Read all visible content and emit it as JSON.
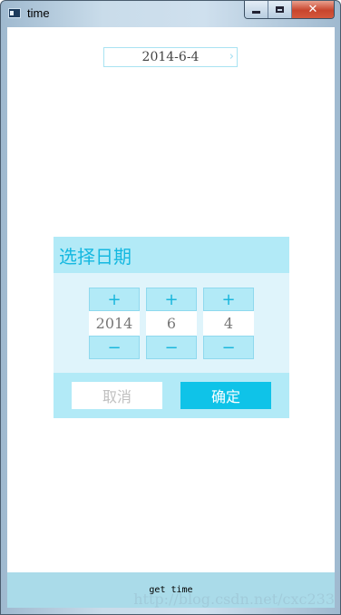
{
  "window": {
    "title": "time",
    "minimize_label": "",
    "maximize_label": "",
    "close_label": "✕"
  },
  "date_display": {
    "value": "2014-6-4",
    "chevron": "›"
  },
  "dialog": {
    "title": "选择日期",
    "plus_label": "+",
    "minus_label": "−",
    "year": "2014",
    "month": "6",
    "day": "4",
    "cancel_label": "取消",
    "ok_label": "确定"
  },
  "bottom": {
    "button_label": "get time",
    "watermark": "http://blog.csdn.net/cxc233"
  },
  "colors": {
    "accent": "#0fc3e8",
    "dialog_header_bg": "#b2eaf7",
    "dialog_body_bg": "#dff4fb",
    "bottom_bar_bg": "#aadbe9"
  }
}
